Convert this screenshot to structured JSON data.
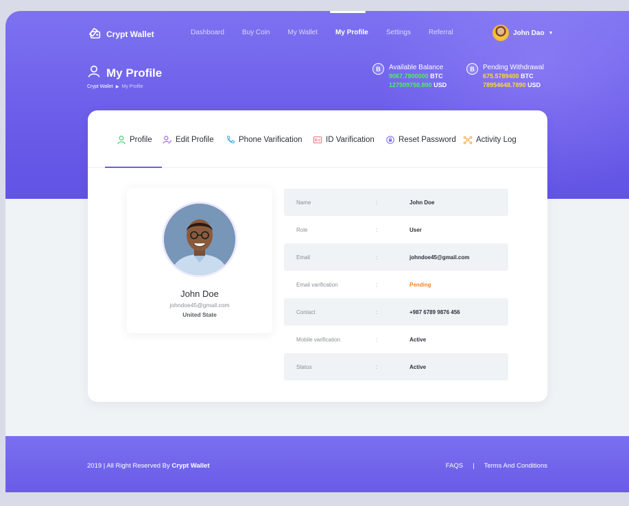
{
  "app": {
    "name": "Crypt Wallet",
    "logo_icon": "wallet-logo-icon"
  },
  "nav": {
    "items": [
      {
        "label": "Dashboard",
        "active": false
      },
      {
        "label": "Buy Coin",
        "active": false
      },
      {
        "label": "My Wallet",
        "active": false
      },
      {
        "label": "My Profile",
        "active": true
      },
      {
        "label": "Settings",
        "active": false
      },
      {
        "label": "Referral",
        "active": false
      }
    ]
  },
  "user_menu": {
    "name": "John Dao",
    "caret": "▼"
  },
  "page": {
    "title": "My Profile",
    "title_icon": "user-outline-icon",
    "breadcrumb": {
      "root": "Crypt Wallet",
      "separator": "▶",
      "current": "My Profile"
    }
  },
  "balances": [
    {
      "label": "Available Balance",
      "icon": "bitcoin-coin-icon",
      "btc_value": "9067.7800000",
      "btc_unit": "BTC",
      "usd_value": "127509750.800",
      "usd_unit": "USD",
      "value_color": "#4cf25e"
    },
    {
      "label": "Pending Withdrawal",
      "icon": "bitcoin-coin-icon",
      "btc_value": "675.5789400",
      "btc_unit": "BTC",
      "usd_value": "78954648.7890",
      "usd_unit": "USD",
      "value_color": "#ffdc2a"
    }
  ],
  "tabs": [
    {
      "label": "Profile",
      "icon": "user-icon",
      "active": true
    },
    {
      "label": "Edit Profile",
      "icon": "edit-user-icon",
      "active": false
    },
    {
      "label": "Phone Varification",
      "icon": "phone-icon",
      "active": false
    },
    {
      "label": "ID Varification",
      "icon": "id-card-icon",
      "active": false
    },
    {
      "label": "Reset Password",
      "icon": "reset-password-icon",
      "active": false
    },
    {
      "label": "Activity Log",
      "icon": "activity-log-icon",
      "active": false
    }
  ],
  "profile_card": {
    "name": "John Doe",
    "email": "johndoe45@gmail.com",
    "country": "United State"
  },
  "details": {
    "separator": ":",
    "rows": [
      {
        "key": "Name",
        "value": "John Doe"
      },
      {
        "key": "Role",
        "value": "User"
      },
      {
        "key": "Email",
        "value": "johndoe45@gmail.com"
      },
      {
        "key": "Email varification",
        "value": "Pending"
      },
      {
        "key": "Contact",
        "value": "+987 6789 9876 456"
      },
      {
        "key": "Mobile varification",
        "value": "Active"
      },
      {
        "key": "Status",
        "value": "Active"
      }
    ]
  },
  "footer": {
    "copyright_prefix": "2019 | All Right Reserved By",
    "copyright_brand": "Crypt Wallet",
    "links": [
      "FAQS",
      "|",
      "Terms And Conditions"
    ]
  },
  "colors": {
    "accent": "#6b5ce7",
    "pending": "#f5821f",
    "available_value": "#4cf25e",
    "pending_value": "#ffdc2a"
  }
}
